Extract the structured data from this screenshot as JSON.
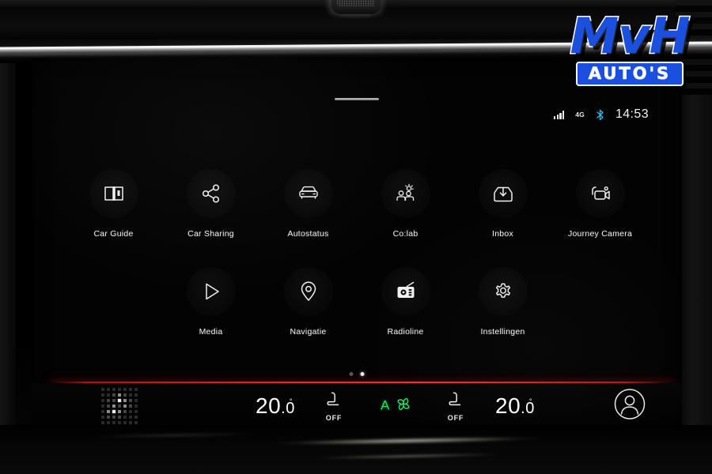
{
  "logo": {
    "brand": "MvH",
    "tagline": "AUTO'S",
    "brand_color": "#1a4fe0"
  },
  "screen": {
    "statusbar": {
      "signal_icon": "signal-bars-icon",
      "network": "4G",
      "bluetooth_icon": "bluetooth-icon",
      "time": "14:53"
    },
    "apps": {
      "rows": [
        [
          {
            "label": "Car Guide",
            "icon": "book-icon"
          },
          {
            "label": "Car Sharing",
            "icon": "share-icon"
          },
          {
            "label": "Autostatus",
            "icon": "car-front-icon"
          },
          {
            "label": "Co:lab",
            "icon": "collaboration-icon"
          },
          {
            "label": "Inbox",
            "icon": "inbox-tray-icon"
          },
          {
            "label": "Journey Camera",
            "icon": "video-camera-icon"
          }
        ],
        [
          {
            "label": "Media",
            "icon": "play-icon"
          },
          {
            "label": "Navigatie",
            "icon": "map-pin-icon"
          },
          {
            "label": "Radioline",
            "icon": "radio-icon"
          },
          {
            "label": "Instellingen",
            "icon": "gear-icon"
          }
        ]
      ]
    },
    "pager": {
      "total": 2,
      "active_index": 1
    },
    "climate": {
      "divider_color": "#ff2020",
      "grid_icon": "dot-matrix-grid-icon",
      "left": {
        "temp_int": "20",
        "temp_frac": ".0",
        "degree": "°",
        "seat_icon": "seat-heater-icon",
        "seat_state": "OFF"
      },
      "auto": {
        "label": "A",
        "fan_icon": "fan-icon",
        "color": "#25e05e"
      },
      "right": {
        "temp_int": "20",
        "temp_frac": ".0",
        "degree": "°",
        "seat_icon": "seat-heater-icon",
        "seat_state": "OFF"
      },
      "profile_icon": "user-profile-icon"
    }
  }
}
